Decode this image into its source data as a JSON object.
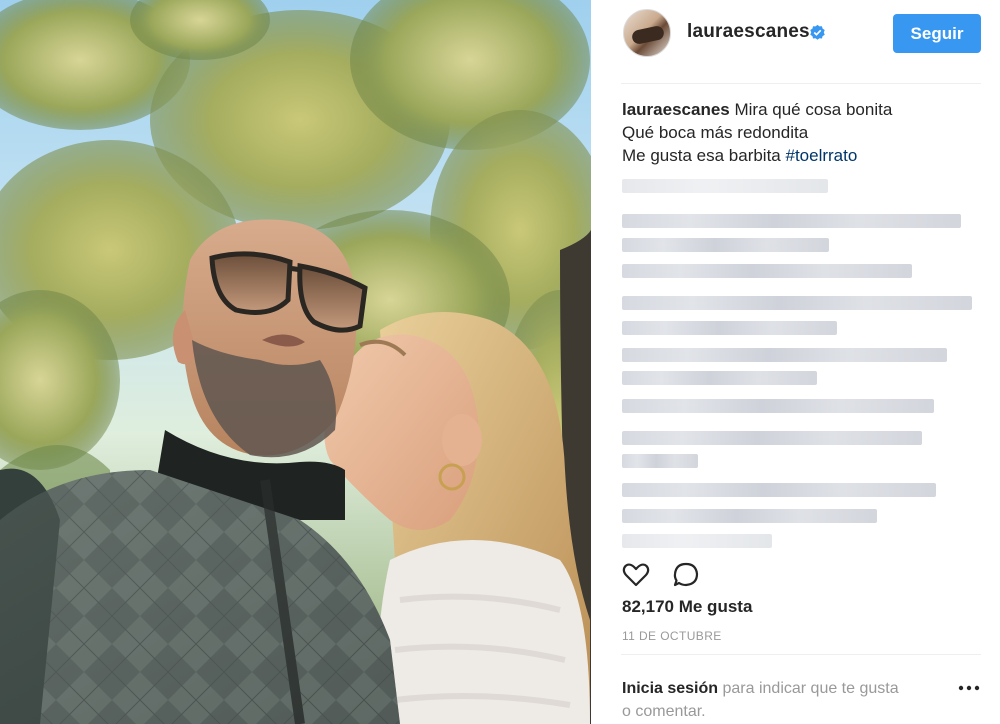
{
  "post": {
    "photo_alt": "",
    "username": "lauraescanes",
    "follow_label": "Seguir",
    "caption": {
      "username": "lauraescanes",
      "line1": "Mira qué cosa bonita",
      "line2": "Qué boca más redondita",
      "line3_text": "Me gusta esa barbita ",
      "hashtag": "#toelrrato"
    },
    "likes": "82,170 Me gusta",
    "date": "11 DE OCTUBRE",
    "login_prompt": {
      "link_login": "Inicia sesión",
      "middle_text": " para indicar que te gusta ",
      "link_comment": "o comentar."
    }
  },
  "icons": [
    "verified-icon",
    "heart-icon",
    "comment-icon",
    "more-options-icon"
  ],
  "colors": {
    "accent": "#3897f0",
    "hashtag": "#003569",
    "muted": "#999999"
  }
}
